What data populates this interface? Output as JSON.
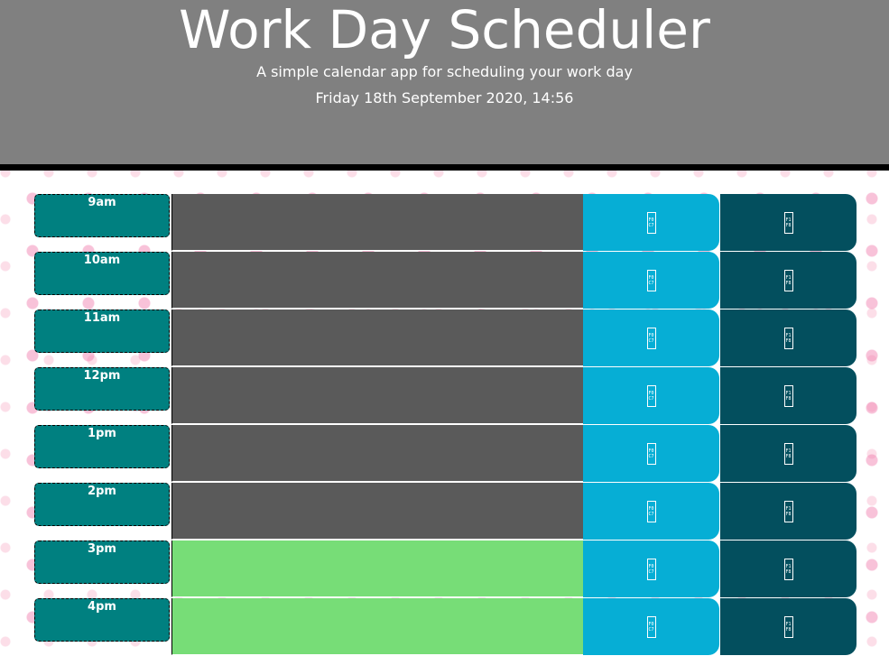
{
  "header": {
    "title": "Work Day Scheduler",
    "subtitle": "A simple calendar app for scheduling your work day",
    "current_day": "Friday 18th September 2020, 14:56"
  },
  "icons": {
    "save_glyph": "F0C7",
    "clear_glyph": "F1F8"
  },
  "colors": {
    "past": "#5a5a5a",
    "future": "#77dd77",
    "hour": "#008080",
    "save": "#06aed5",
    "clear": "#034f5e"
  },
  "rows": [
    {
      "hour": "9am",
      "state": "past",
      "text": ""
    },
    {
      "hour": "10am",
      "state": "past",
      "text": ""
    },
    {
      "hour": "11am",
      "state": "past",
      "text": ""
    },
    {
      "hour": "12pm",
      "state": "past",
      "text": ""
    },
    {
      "hour": "1pm",
      "state": "past",
      "text": ""
    },
    {
      "hour": "2pm",
      "state": "past",
      "text": ""
    },
    {
      "hour": "3pm",
      "state": "future",
      "text": ""
    },
    {
      "hour": "4pm",
      "state": "future",
      "text": ""
    }
  ]
}
